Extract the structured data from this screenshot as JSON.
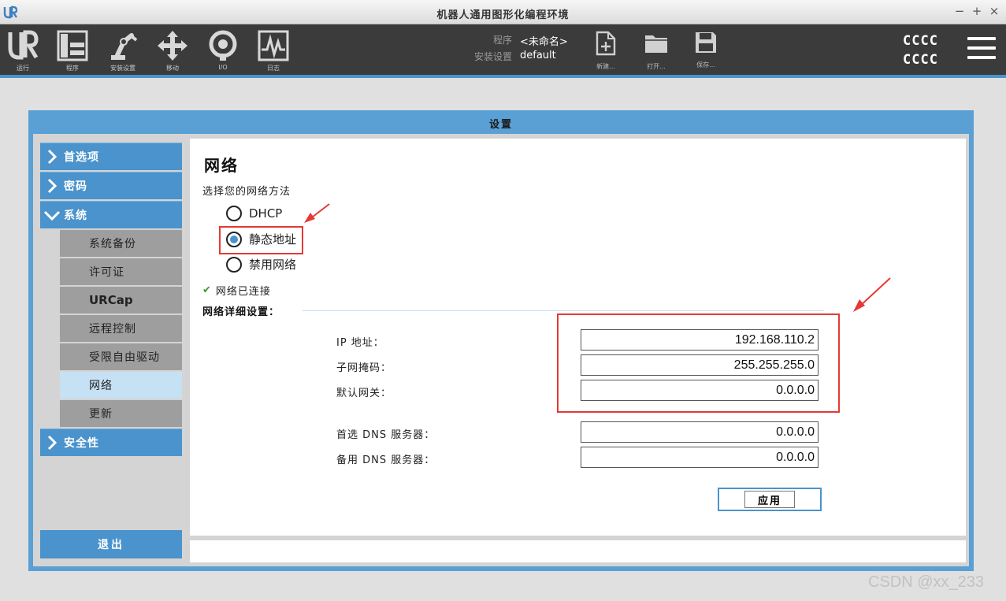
{
  "window": {
    "title": "机器人通用图形化编程环境",
    "controls": [
      "−",
      "+",
      "×"
    ]
  },
  "toolbar": {
    "items": [
      {
        "label": "运行",
        "icon": "ur-logo-icon"
      },
      {
        "label": "程序",
        "icon": "program-icon"
      },
      {
        "label": "安装设置",
        "icon": "robot-arm-icon"
      },
      {
        "label": "移动",
        "icon": "move-arrows-icon"
      },
      {
        "label": "I/O",
        "icon": "io-icon"
      },
      {
        "label": "日志",
        "icon": "log-icon"
      }
    ],
    "program_key": "程序",
    "program_value": "<未命名>",
    "install_key": "安装设置",
    "install_value": "default",
    "file_items": [
      {
        "label": "新建...",
        "icon": "new-file-icon"
      },
      {
        "label": "打开...",
        "icon": "open-folder-icon"
      },
      {
        "label": "保存...",
        "icon": "save-icon"
      }
    ],
    "status_line1": "CCCC",
    "status_line2": "CCCC"
  },
  "dialog": {
    "title": "设置",
    "sidebar": {
      "items": [
        {
          "label": "首选项",
          "type": "main",
          "expanded": false
        },
        {
          "label": "密码",
          "type": "main",
          "expanded": false
        },
        {
          "label": "系统",
          "type": "main",
          "expanded": true
        },
        {
          "label": "系统备份",
          "type": "sub"
        },
        {
          "label": "许可证",
          "type": "sub"
        },
        {
          "label": "URCap",
          "type": "sub"
        },
        {
          "label": "远程控制",
          "type": "sub"
        },
        {
          "label": "受限自由驱动",
          "type": "sub"
        },
        {
          "label": "网络",
          "type": "sub",
          "active": true
        },
        {
          "label": "更新",
          "type": "sub"
        },
        {
          "label": "安全性",
          "type": "main",
          "expanded": false
        }
      ],
      "exit_label": "退出"
    },
    "network": {
      "title": "网络",
      "subtitle": "选择您的网络方法",
      "methods": [
        {
          "label": "DHCP",
          "selected": false
        },
        {
          "label": "静态地址",
          "selected": true
        },
        {
          "label": "禁用网络",
          "selected": false
        }
      ],
      "status": "网络已连接",
      "details_title": "网络详细设置：",
      "fields": [
        {
          "label": "IP 地址：",
          "value": "192.168.110.2"
        },
        {
          "label": "子网掩码：",
          "value": "255.255.255.0"
        },
        {
          "label": "默认网关：",
          "value": "0.0.0.0"
        },
        {
          "label": "首选 DNS 服务器：",
          "value": "0.0.0.0"
        },
        {
          "label": "备用 DNS 服务器：",
          "value": "0.0.0.0"
        }
      ],
      "apply_label": "应用"
    }
  },
  "watermark": "CSDN @xx_233",
  "colors": {
    "accent": "#4a93cc",
    "toolbar_bg": "#3b3b3b",
    "annotation": "#e53935",
    "selected_nav": "#c6e0f4"
  }
}
